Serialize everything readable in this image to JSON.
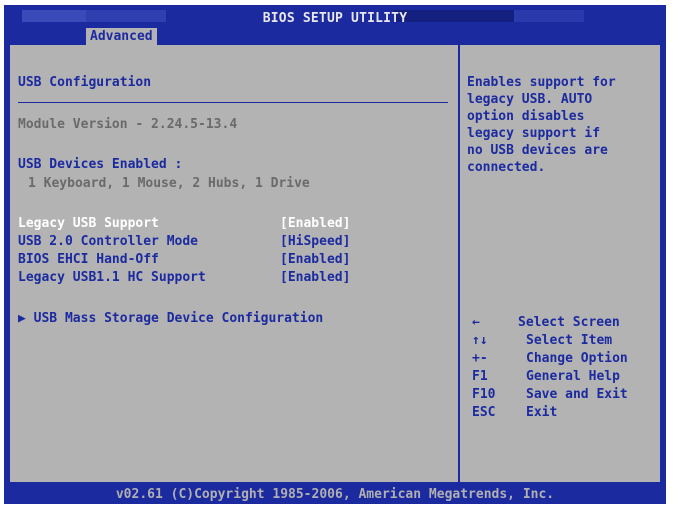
{
  "header": {
    "title": "BIOS SETUP UTILITY",
    "active_tab": "Advanced"
  },
  "left": {
    "section_title": "USB Configuration",
    "module_version": "Module Version - 2.24.5-13.4",
    "devices_label": "USB Devices Enabled :",
    "devices_value": "1 Keyboard, 1 Mouse, 2 Hubs, 1 Drive",
    "settings": [
      {
        "label": "Legacy USB Support",
        "value": "[Enabled]"
      },
      {
        "label": "USB 2.0 Controller Mode",
        "value": "[HiSpeed]"
      },
      {
        "label": "BIOS EHCI Hand-Off",
        "value": "[Enabled]"
      },
      {
        "label": "Legacy USB1.1 HC Support",
        "value": "[Enabled]"
      }
    ],
    "submenu": {
      "arrow": "▶",
      "label": "USB Mass Storage Device Configuration"
    }
  },
  "help": {
    "lines": [
      "Enables support for",
      "legacy USB. AUTO",
      "option disables",
      "legacy support if",
      "no USB devices are",
      "connected."
    ]
  },
  "keys": [
    {
      "key": "←",
      "desc": "Select Screen"
    },
    {
      "key": "↑↓",
      "desc": "Select Item"
    },
    {
      "key": "+-",
      "desc": "Change Option"
    },
    {
      "key": "F1",
      "desc": "General Help"
    },
    {
      "key": "F10",
      "desc": "Save and Exit"
    },
    {
      "key": "ESC",
      "desc": "Exit"
    }
  ],
  "footer": {
    "copyright": "v02.61 (C)Copyright 1985-2006, American Megatrends, Inc."
  }
}
